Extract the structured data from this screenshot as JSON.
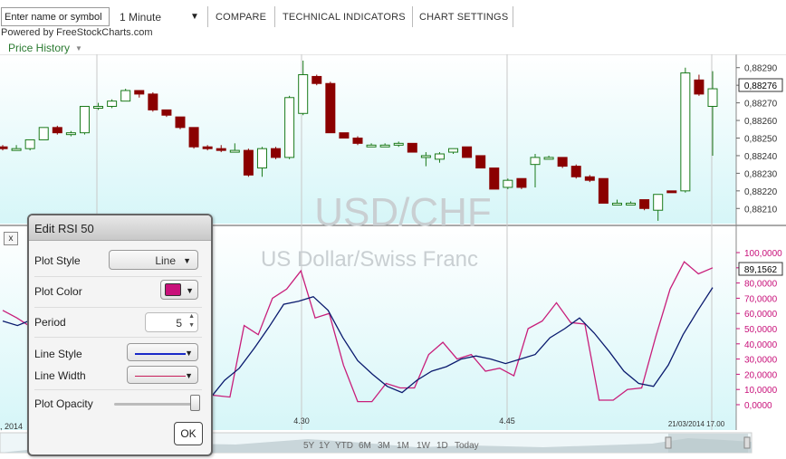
{
  "toolbar": {
    "symbol_placeholder": "Enter name or symbol",
    "interval": "1 Minute",
    "compare": "COMPARE",
    "technical_indicators": "TECHNICAL INDICATORS",
    "chart_settings": "CHART SETTINGS"
  },
  "powered_by": "Powered by FreeStockCharts.com",
  "price_history": "Price History",
  "watermark": {
    "symbol": "USD/CHF",
    "name": "US Dollar/Swiss Franc"
  },
  "price_axis": {
    "ticks": [
      "0,88290",
      "0,88280",
      "0,88270",
      "0,88260",
      "0,88250",
      "0,88240",
      "0,88230",
      "0,88220",
      "0,88210"
    ],
    "current": "0,88276"
  },
  "rsi_axis": {
    "ticks": [
      "100,0000",
      "90,0000",
      "80,0000",
      "70,0000",
      "60,0000",
      "50,0000",
      "40,0000",
      "30,0000",
      "20,0000",
      "10,0000",
      "0,0000"
    ],
    "current": "89,1562"
  },
  "time_axis": {
    "labels": [
      ", 2014",
      "4.30",
      "4.45",
      "21/03/2014 17.00"
    ]
  },
  "navigator": {
    "buttons": [
      "5Y",
      "1Y",
      "YTD",
      "6M",
      "3M",
      "1M",
      "1W",
      "1D",
      "Today"
    ]
  },
  "dialog": {
    "title": "Edit RSI 50",
    "plot_style_label": "Plot Style",
    "plot_style_value": "Line",
    "plot_color_label": "Plot Color",
    "period_label": "Period",
    "period_value": "5",
    "line_style_label": "Line Style",
    "line_width_label": "Line Width",
    "plot_opacity_label": "Plot Opacity",
    "plot_opacity": 1.0,
    "ok": "OK",
    "plot_color": "#c8107a"
  },
  "close_label": "x",
  "colors": {
    "up": "#1a7a1a",
    "down": "#8b0000",
    "rsi_fast": "#c81e7a",
    "rsi_slow": "#0a1a6e",
    "rsi_axis": "#c8107a"
  },
  "chart_data": [
    {
      "type": "candlestick",
      "title": "USD/CHF",
      "ylim": [
        0.88205,
        0.88295
      ],
      "candles": [
        {
          "o": 0.88245,
          "h": 0.88246,
          "c": 0.88244,
          "l": 0.88243
        },
        {
          "o": 0.88244,
          "h": 0.88246,
          "c": 0.88244,
          "l": 0.88243
        },
        {
          "o": 0.88244,
          "h": 0.88249,
          "c": 0.88249,
          "l": 0.88243
        },
        {
          "o": 0.88249,
          "h": 0.88256,
          "c": 0.88256,
          "l": 0.88249
        },
        {
          "o": 0.88256,
          "h": 0.88257,
          "c": 0.88253,
          "l": 0.88252
        },
        {
          "o": 0.88252,
          "h": 0.88254,
          "c": 0.88253,
          "l": 0.88251
        },
        {
          "o": 0.88253,
          "h": 0.88268,
          "c": 0.88268,
          "l": 0.88252
        },
        {
          "o": 0.88268,
          "h": 0.8827,
          "c": 0.88268,
          "l": 0.88266
        },
        {
          "o": 0.88268,
          "h": 0.88272,
          "c": 0.88271,
          "l": 0.88267
        },
        {
          "o": 0.88271,
          "h": 0.88278,
          "c": 0.88277,
          "l": 0.88271
        },
        {
          "o": 0.88277,
          "h": 0.88277,
          "c": 0.88275,
          "l": 0.88273
        },
        {
          "o": 0.88275,
          "h": 0.88276,
          "c": 0.88266,
          "l": 0.88265
        },
        {
          "o": 0.88266,
          "h": 0.88266,
          "c": 0.88263,
          "l": 0.88262
        },
        {
          "o": 0.88262,
          "h": 0.88262,
          "c": 0.88256,
          "l": 0.88255
        },
        {
          "o": 0.88256,
          "h": 0.88256,
          "c": 0.88245,
          "l": 0.88244
        },
        {
          "o": 0.88245,
          "h": 0.88246,
          "c": 0.88244,
          "l": 0.88243
        },
        {
          "o": 0.88244,
          "h": 0.88246,
          "c": 0.88243,
          "l": 0.88242
        },
        {
          "o": 0.88243,
          "h": 0.88247,
          "c": 0.88243,
          "l": 0.88242
        },
        {
          "o": 0.88243,
          "h": 0.88244,
          "c": 0.88229,
          "l": 0.88228
        },
        {
          "o": 0.88233,
          "h": 0.88245,
          "c": 0.88244,
          "l": 0.88228
        },
        {
          "o": 0.88244,
          "h": 0.88245,
          "c": 0.88239,
          "l": 0.88238
        },
        {
          "o": 0.88239,
          "h": 0.88274,
          "c": 0.88273,
          "l": 0.88238
        },
        {
          "o": 0.88264,
          "h": 0.88294,
          "c": 0.88286,
          "l": 0.88263
        },
        {
          "o": 0.88285,
          "h": 0.88286,
          "c": 0.88281,
          "l": 0.8828
        },
        {
          "o": 0.88281,
          "h": 0.88282,
          "c": 0.88253,
          "l": 0.88253
        },
        {
          "o": 0.88253,
          "h": 0.88253,
          "c": 0.8825,
          "l": 0.8825
        },
        {
          "o": 0.8825,
          "h": 0.88251,
          "c": 0.88247,
          "l": 0.88246
        },
        {
          "o": 0.88246,
          "h": 0.88247,
          "c": 0.88246,
          "l": 0.88245
        },
        {
          "o": 0.88246,
          "h": 0.88247,
          "c": 0.88246,
          "l": 0.88245
        },
        {
          "o": 0.88246,
          "h": 0.88248,
          "c": 0.88247,
          "l": 0.88245
        },
        {
          "o": 0.88247,
          "h": 0.88247,
          "c": 0.88242,
          "l": 0.88242
        },
        {
          "o": 0.8824,
          "h": 0.88242,
          "c": 0.8824,
          "l": 0.88234
        },
        {
          "o": 0.88238,
          "h": 0.88242,
          "c": 0.88241,
          "l": 0.88236
        },
        {
          "o": 0.88242,
          "h": 0.88244,
          "c": 0.88244,
          "l": 0.88241
        },
        {
          "o": 0.88245,
          "h": 0.88245,
          "c": 0.88239,
          "l": 0.88239
        },
        {
          "o": 0.8824,
          "h": 0.8824,
          "c": 0.88233,
          "l": 0.88233
        },
        {
          "o": 0.88233,
          "h": 0.88233,
          "c": 0.88221,
          "l": 0.88221
        },
        {
          "o": 0.88222,
          "h": 0.88227,
          "c": 0.88226,
          "l": 0.88221
        },
        {
          "o": 0.88227,
          "h": 0.88227,
          "c": 0.88222,
          "l": 0.88221
        },
        {
          "o": 0.88235,
          "h": 0.88241,
          "c": 0.88239,
          "l": 0.88222
        },
        {
          "o": 0.88239,
          "h": 0.8824,
          "c": 0.88239,
          "l": 0.88238
        },
        {
          "o": 0.88239,
          "h": 0.88239,
          "c": 0.88234,
          "l": 0.88233
        },
        {
          "o": 0.88234,
          "h": 0.88235,
          "c": 0.88228,
          "l": 0.88227
        },
        {
          "o": 0.88228,
          "h": 0.88229,
          "c": 0.88226,
          "l": 0.88225
        },
        {
          "o": 0.88227,
          "h": 0.88227,
          "c": 0.88213,
          "l": 0.88213
        },
        {
          "o": 0.88213,
          "h": 0.88215,
          "c": 0.88213,
          "l": 0.88212
        },
        {
          "o": 0.88213,
          "h": 0.88214,
          "c": 0.88213,
          "l": 0.88212
        },
        {
          "o": 0.88215,
          "h": 0.88215,
          "c": 0.8821,
          "l": 0.88209
        },
        {
          "o": 0.88209,
          "h": 0.88218,
          "c": 0.88218,
          "l": 0.88203
        },
        {
          "o": 0.8822,
          "h": 0.8822,
          "c": 0.88219,
          "l": 0.88219
        },
        {
          "o": 0.8822,
          "h": 0.8829,
          "c": 0.88287,
          "l": 0.88219
        },
        {
          "o": 0.88283,
          "h": 0.88286,
          "c": 0.88275,
          "l": 0.88274
        },
        {
          "o": 0.88268,
          "h": 0.88288,
          "c": 0.88278,
          "l": 0.8824
        }
      ]
    },
    {
      "type": "line",
      "title": "RSI",
      "ylim": [
        0,
        100
      ],
      "series": [
        {
          "values": [
            62,
            57,
            51,
            57,
            61,
            45,
            50,
            44,
            38,
            28,
            30,
            22,
            18,
            8,
            7,
            6,
            5,
            52,
            46,
            70,
            76,
            88,
            57,
            60,
            26,
            2,
            2,
            14,
            11,
            11,
            33,
            41,
            30,
            33,
            22,
            24,
            19,
            50,
            55,
            67,
            54,
            53,
            3,
            3,
            10,
            11,
            45,
            76,
            94,
            86,
            90
          ]
        },
        {
          "values": [
            55,
            52,
            56,
            58,
            60,
            54,
            46,
            40,
            36,
            30,
            28,
            24,
            16,
            8,
            4,
            16,
            24,
            37,
            51,
            66,
            68,
            71,
            62,
            44,
            29,
            20,
            12,
            8,
            16,
            22,
            25,
            30,
            32,
            30,
            27,
            30,
            33,
            44,
            50,
            57,
            47,
            35,
            22,
            14,
            12,
            26,
            46,
            62,
            77
          ]
        }
      ]
    }
  ]
}
